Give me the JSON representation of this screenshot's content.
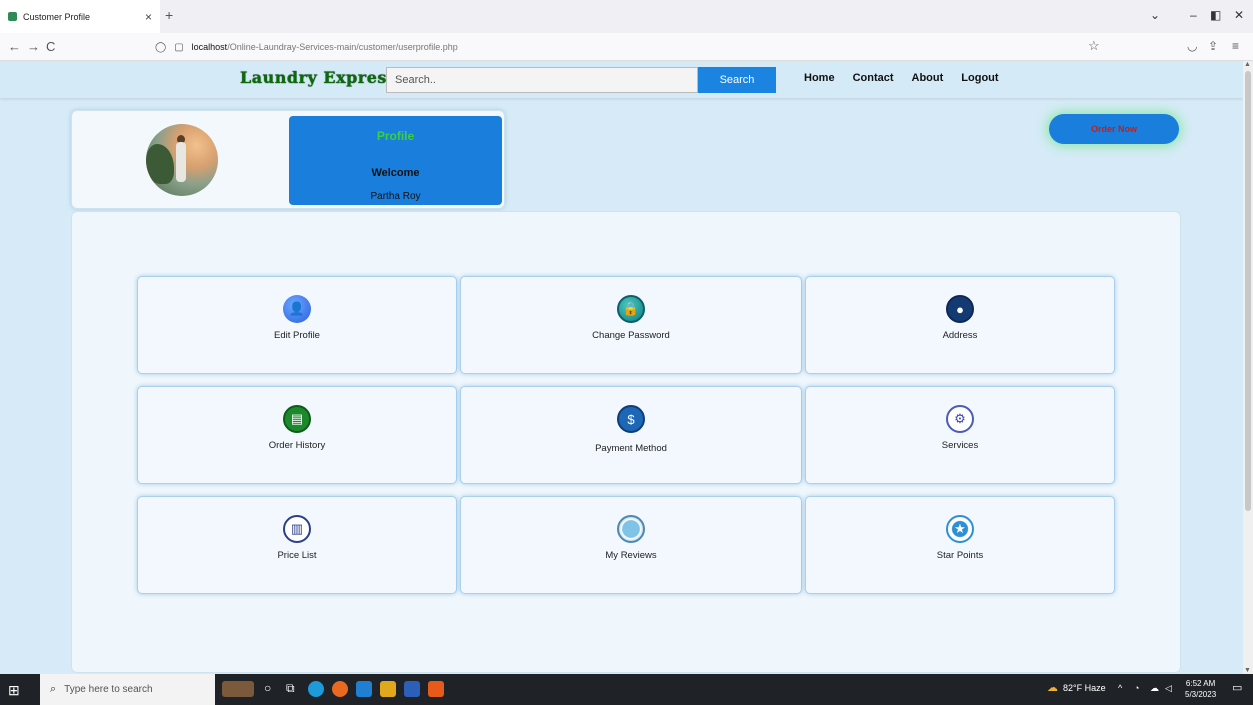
{
  "browser": {
    "tab_title": "Customer Profile",
    "tab_close": "×",
    "new_tab": "+",
    "url_host": "localhost",
    "url_path": "/Online-Laundray-Services-main/customer/userprofile.php",
    "back": "←",
    "forward": "→",
    "reload": "C"
  },
  "header": {
    "logo": "Laundry Express",
    "search_placeholder": "Search..",
    "search_button": "Search",
    "nav": [
      "Home",
      "Contact",
      "About",
      "Logout"
    ]
  },
  "profile": {
    "heading": "Profile",
    "welcome": "Welcome",
    "name": "Partha Roy"
  },
  "order_button": "Order Now",
  "tiles": [
    {
      "label": "Edit Profile",
      "icon": "user-edit-icon"
    },
    {
      "label": "Change Password",
      "icon": "lock-icon"
    },
    {
      "label": "Address",
      "icon": "location-pin-icon"
    },
    {
      "label": "Order History",
      "icon": "book-icon"
    },
    {
      "label": "Payment Method",
      "icon": "payment-icon"
    },
    {
      "label": "Services",
      "icon": "gear-hands-icon"
    },
    {
      "label": "Price List",
      "icon": "receipt-icon"
    },
    {
      "label": "My Reviews",
      "icon": "review-icon"
    },
    {
      "label": "Star Points",
      "icon": "star-icon"
    }
  ],
  "taskbar": {
    "search_placeholder": "Type here to search",
    "weather": "82°F Haze",
    "time": "6:52 AM",
    "date": "5/3/2023"
  },
  "colors": {
    "brand_green": "#0a6b0a",
    "primary_blue": "#1a7fdc",
    "order_text_red": "#c0201a",
    "page_background": "#d6ebf7"
  }
}
